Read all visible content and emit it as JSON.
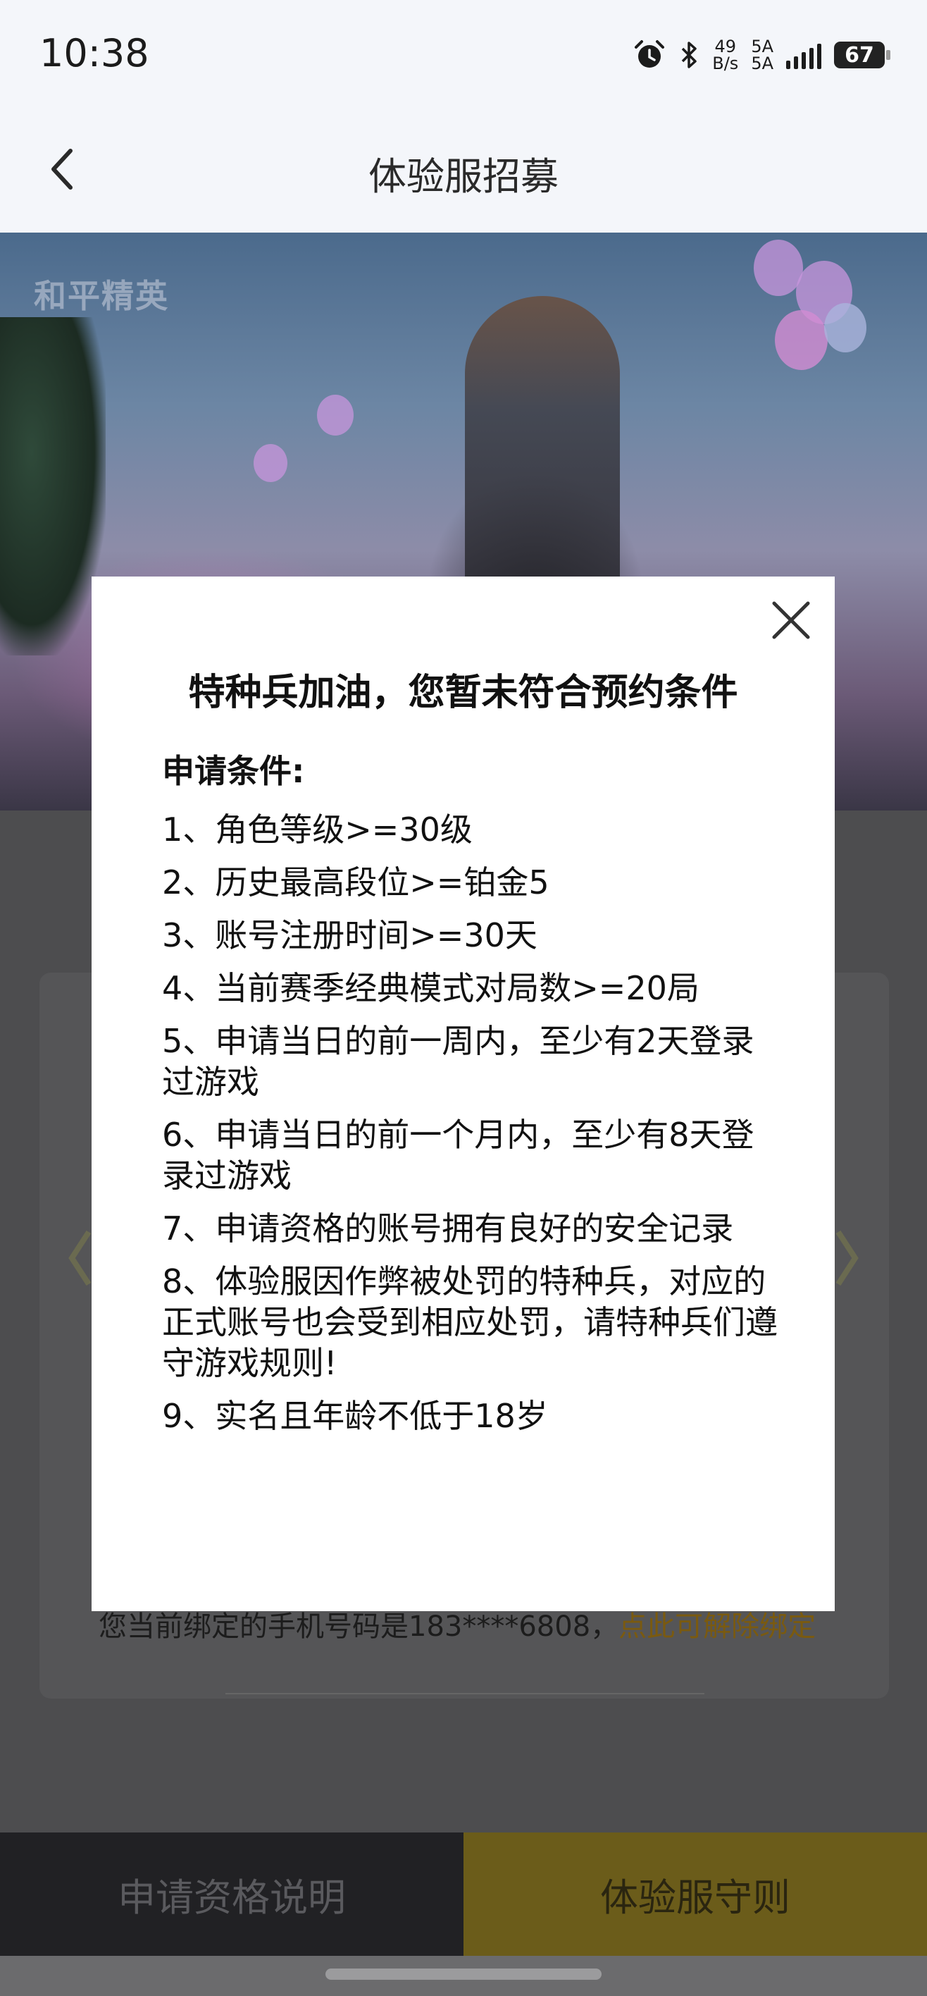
{
  "status_bar": {
    "time": "10:38",
    "net_speed_value": "49",
    "net_speed_unit": "B/s",
    "network_label_top": "5A",
    "network_label_bottom": "5A",
    "battery": "67",
    "icons": [
      "alarm-icon",
      "bluetooth-icon",
      "signal-icon",
      "battery-icon"
    ]
  },
  "header": {
    "title": "体验服招募",
    "back_icon": "chevron-left-icon"
  },
  "banner": {
    "logo_text": "和平精英"
  },
  "page": {
    "phone_text": "您当前绑定的手机号码是183****6808，",
    "unbind_link": "点此可解除绑定"
  },
  "bottom_bar": {
    "left_label": "申请资格说明",
    "right_label": "体验服守则"
  },
  "modal": {
    "title": "特种兵加油，您暂未符合预约条件",
    "conditions_heading": "申请条件:",
    "conditions": [
      "1、角色等级>=30级",
      "2、历史最高段位>=铂金5",
      "3、账号注册时间>=30天",
      "4、当前赛季经典模式对局数>=20局",
      "5、申请当日的前一周内，至少有2天登录过游戏",
      "6、申请当日的前一个月内，至少有8天登录过游戏",
      "7、申请资格的账号拥有良好的安全记录",
      "8、体验服因作弊被处罚的特种兵，对应的正式账号也会受到相应处罚，请特种兵们遵守游戏规则!",
      "9、实名且年龄不低于18岁"
    ]
  },
  "colors": {
    "modal_bg": "#ffffff",
    "header_bg": "#f4f6fa",
    "accent_gold": "#f2c21c",
    "unbind_link": "#d29a1a"
  }
}
